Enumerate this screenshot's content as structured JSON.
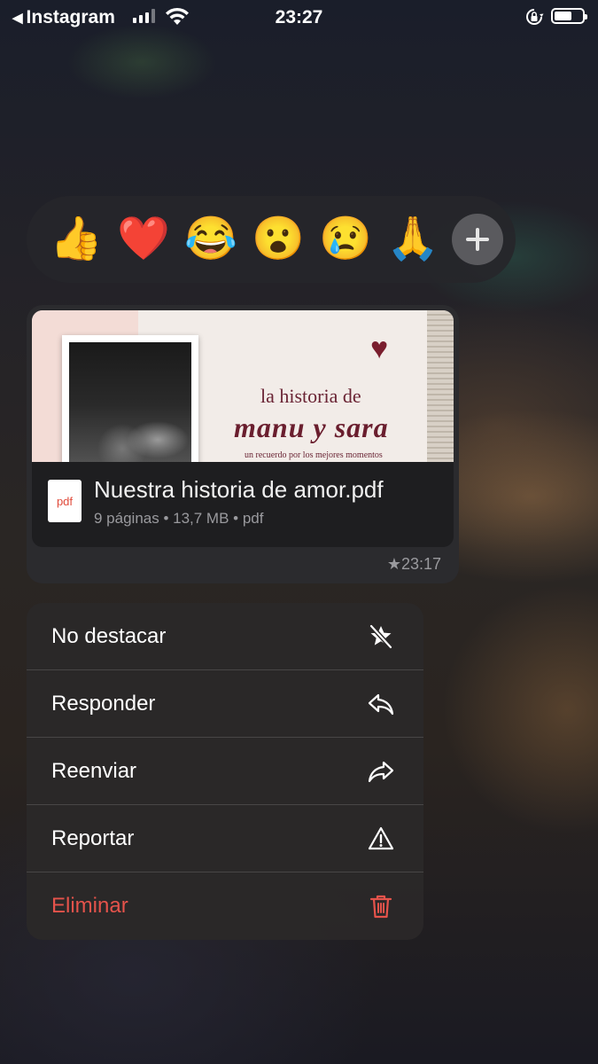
{
  "status_bar": {
    "back_app": "Instagram",
    "time": "23:27",
    "battery_level": 0.65
  },
  "reactions": {
    "emojis": [
      "👍",
      "❤️",
      "😂",
      "😮",
      "😢",
      "🙏"
    ],
    "more_label": "+"
  },
  "message": {
    "preview": {
      "line1": "la historia de",
      "line2": "manu y sara",
      "line3": "un recuerdo por los mejores momentos"
    },
    "file_name": "Nuestra historia de amor.pdf",
    "file_meta": "9 páginas • 13,7 MB • pdf",
    "file_type_label": "pdf",
    "time": "★23:17"
  },
  "menu": {
    "items": [
      {
        "label": "No destacar",
        "icon": "unstar-icon"
      },
      {
        "label": "Responder",
        "icon": "reply-icon"
      },
      {
        "label": "Reenviar",
        "icon": "forward-icon"
      },
      {
        "label": "Reportar",
        "icon": "warning-icon"
      },
      {
        "label": "Eliminar",
        "icon": "trash-icon"
      }
    ]
  },
  "colors": {
    "danger": "#e5534b",
    "accent_wine": "#6a1e2e"
  }
}
